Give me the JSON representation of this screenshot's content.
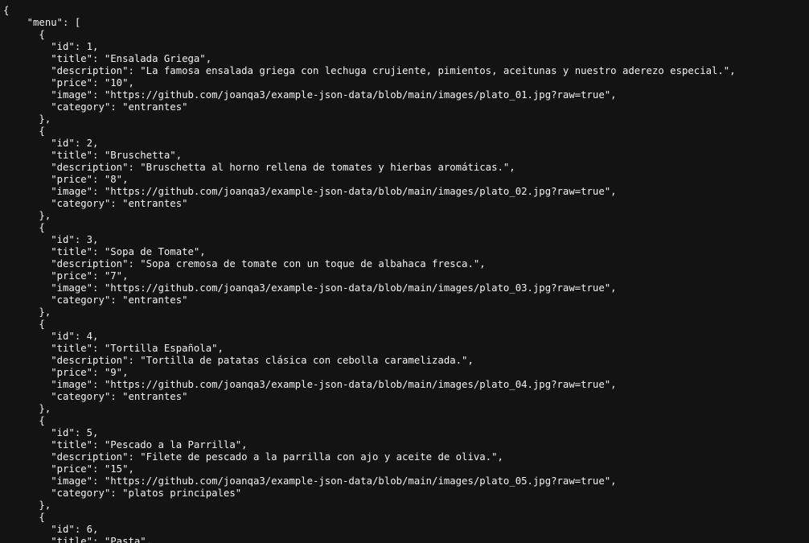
{
  "json_viewer": {
    "lines": [
      "{",
      "    \"menu\": [",
      "      {",
      "        \"id\": 1,",
      "        \"title\": \"Ensalada Griega\",",
      "        \"description\": \"La famosa ensalada griega con lechuga crujiente, pimientos, aceitunas y nuestro aderezo especial.\",",
      "        \"price\": \"10\",",
      "        \"image\": \"https://github.com/joanqa3/example-json-data/blob/main/images/plato_01.jpg?raw=true\",",
      "        \"category\": \"entrantes\"",
      "      },",
      "      {",
      "        \"id\": 2,",
      "        \"title\": \"Bruschetta\",",
      "        \"description\": \"Bruschetta al horno rellena de tomates y hierbas aromáticas.\",",
      "        \"price\": \"8\",",
      "        \"image\": \"https://github.com/joanqa3/example-json-data/blob/main/images/plato_02.jpg?raw=true\",",
      "        \"category\": \"entrantes\"",
      "      },",
      "      {",
      "        \"id\": 3,",
      "        \"title\": \"Sopa de Tomate\",",
      "        \"description\": \"Sopa cremosa de tomate con un toque de albahaca fresca.\",",
      "        \"price\": \"7\",",
      "        \"image\": \"https://github.com/joanqa3/example-json-data/blob/main/images/plato_03.jpg?raw=true\",",
      "        \"category\": \"entrantes\"",
      "      },",
      "      {",
      "        \"id\": 4,",
      "        \"title\": \"Tortilla Española\",",
      "        \"description\": \"Tortilla de patatas clásica con cebolla caramelizada.\",",
      "        \"price\": \"9\",",
      "        \"image\": \"https://github.com/joanqa3/example-json-data/blob/main/images/plato_04.jpg?raw=true\",",
      "        \"category\": \"entrantes\"",
      "      },",
      "      {",
      "        \"id\": 5,",
      "        \"title\": \"Pescado a la Parrilla\",",
      "        \"description\": \"Filete de pescado a la parrilla con ajo y aceite de oliva.\",",
      "        \"price\": \"15\",",
      "        \"image\": \"https://github.com/joanqa3/example-json-data/blob/main/images/plato_05.jpg?raw=true\",",
      "        \"category\": \"platos principales\"",
      "      },",
      "      {",
      "        \"id\": 6,",
      "        \"title\": \"Pasta\","
    ]
  }
}
